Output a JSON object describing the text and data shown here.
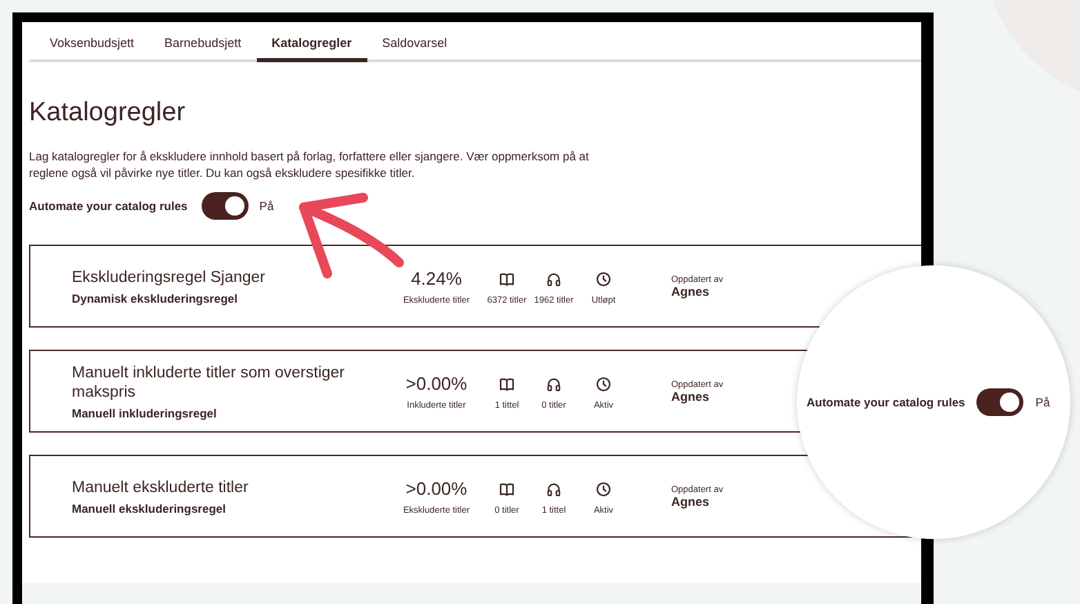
{
  "tabs": [
    {
      "label": "Voksenbudsjett",
      "selected": false
    },
    {
      "label": "Barnebudsjett",
      "selected": false
    },
    {
      "label": "Katalogregler",
      "selected": true
    },
    {
      "label": "Saldovarsel",
      "selected": false
    }
  ],
  "heading": "Katalogregler",
  "description": "Lag katalogregler for å ekskludere innhold basert på forlag, forfattere eller sjangere. Vær oppmerksom på at reglene også vil påvirke nye titler. Du kan også ekskludere spesifikke titler.",
  "automate": {
    "label": "Automate your catalog rules",
    "on": true,
    "state_text": "På"
  },
  "rules": [
    {
      "title": "Ekskluderingsregel Sjanger",
      "subtitle": "Dynamisk ekskluderingsregel",
      "percentage": "4.24%",
      "percentage_label": "Ekskluderte titler",
      "ebook_titles": "6372 titler",
      "audio_titles": "1962 titler",
      "status": "Utløpt",
      "updated_label": "Oppdatert av",
      "updated_by": "Agnes"
    },
    {
      "title": "Manuelt inkluderte titler som overstiger makspris",
      "subtitle": "Manuell inkluderingsregel",
      "percentage": ">0.00%",
      "percentage_label": "Inkluderte titler",
      "ebook_titles": "1 tittel",
      "audio_titles": "0 titler",
      "status": "Aktiv",
      "updated_label": "Oppdatert av",
      "updated_by": "Agnes"
    },
    {
      "title": "Manuelt ekskluderte titler",
      "subtitle": "Manuell ekskluderingsregel",
      "percentage": ">0.00%",
      "percentage_label": "Ekskluderte titler",
      "ebook_titles": "0 titler",
      "audio_titles": "1 tittel",
      "status": "Aktiv",
      "updated_label": "Oppdatert av",
      "updated_by": "Agnes"
    }
  ],
  "magnifier": {
    "label": "Automate your catalog rules",
    "on": true,
    "state_text": "På"
  }
}
